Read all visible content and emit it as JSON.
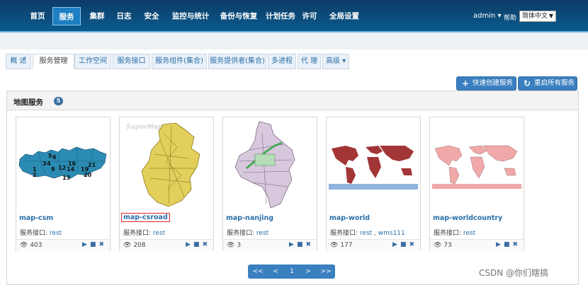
{
  "nav": {
    "items": [
      "首页",
      "服务",
      "集群",
      "日志",
      "安全",
      "监控与统计",
      "备份与恢复",
      "计划任务",
      "许可",
      "全局设置"
    ],
    "active": "服务",
    "user": "admin ▾",
    "help": "帮助",
    "language": "简体中文"
  },
  "tabs": [
    "概 述",
    "服务管理",
    "工作空间",
    "服务接口",
    "服务组件(集合)",
    "服务提供者(集合)",
    "多进程",
    "代 理",
    "高级 ▾"
  ],
  "toolbar": {
    "quick_create": "快速创建服务",
    "restart_all": "重启所有服务"
  },
  "panel": {
    "title": "地图服务",
    "count": "5"
  },
  "cards": [
    {
      "name": "map-csm",
      "api_label": "服务接口:",
      "api": "rest",
      "views": "403"
    },
    {
      "name": "map-csroad",
      "api_label": "服务接口:",
      "api": "rest",
      "views": "208"
    },
    {
      "name": "map-nanjing",
      "api_label": "服务接口:",
      "api": "rest",
      "views": "3"
    },
    {
      "name": "map-world",
      "api_label": "服务接口:",
      "api": "rest , wms111",
      "views": "177"
    },
    {
      "name": "map-worldcountry",
      "api_label": "服务接口:",
      "api": "rest",
      "views": "73"
    }
  ],
  "thumb_text": {
    "csm_labels": [
      "5",
      "6",
      "3",
      "4",
      "1",
      "9",
      "2",
      "12",
      "16",
      "14",
      "19",
      "21",
      "20",
      "13"
    ],
    "csroad_brand": "SuperMap"
  },
  "pager": [
    "<<",
    "<",
    "1",
    ">",
    ">>"
  ],
  "watermark": "CSDN @你们瞎搞",
  "colors": {
    "nav_bg": "#0d3b66",
    "accent": "#3a7fbf",
    "link": "#2a6fa8",
    "selected_outline": "#e0242c"
  }
}
